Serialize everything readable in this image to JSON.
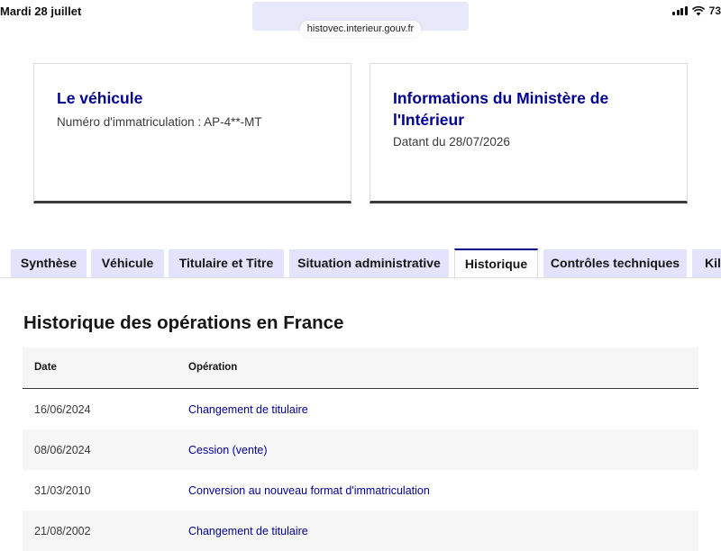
{
  "status_bar": {
    "date": "Mardi 28 juillet",
    "battery": "73"
  },
  "browser": {
    "url": "histovec.interieur.gouv.fr"
  },
  "cards": [
    {
      "title": "Le véhicule",
      "text": "Numéro d'immatriculation : AP-4**-MT"
    },
    {
      "title": "Informations du Ministère de l'Intérieur",
      "text": "Datant du 28/07/2026"
    }
  ],
  "tabs": [
    {
      "label": "Synthèse",
      "active": false
    },
    {
      "label": "Véhicule",
      "active": false
    },
    {
      "label": "Titulaire et Titre",
      "active": false
    },
    {
      "label": "Situation administrative",
      "active": false
    },
    {
      "label": "Historique",
      "active": true
    },
    {
      "label": "Contrôles techniques",
      "active": false
    },
    {
      "label": "Kil",
      "active": false
    }
  ],
  "history": {
    "title": "Historique des opérations en France",
    "columns": [
      "Date",
      "Opération"
    ],
    "rows": [
      {
        "date": "16/06/2024",
        "operation": "Changement de titulaire"
      },
      {
        "date": "08/06/2024",
        "operation": "Cession (vente)"
      },
      {
        "date": "31/03/2010",
        "operation": "Conversion au nouveau format d'immatriculation"
      },
      {
        "date": "21/08/2002",
        "operation": "Changement de titulaire"
      }
    ]
  },
  "colors": {
    "accent": "#000091",
    "tab_bg": "#e3e3fd",
    "row_alt": "#f6f6f6",
    "text": "#161616"
  }
}
